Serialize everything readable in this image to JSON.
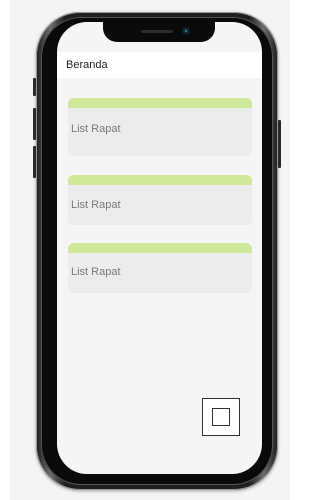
{
  "header": {
    "title": "Beranda"
  },
  "cards": [
    {
      "label": "List Rapat"
    },
    {
      "label": "List Rapat"
    },
    {
      "label": "List Rapat"
    }
  ],
  "fab": {
    "icon": "square-icon"
  },
  "colors": {
    "card_accent": "#cfe89a",
    "card_background": "#ececec",
    "screen_background": "#f5f5f5",
    "header_background": "#ffffff"
  }
}
